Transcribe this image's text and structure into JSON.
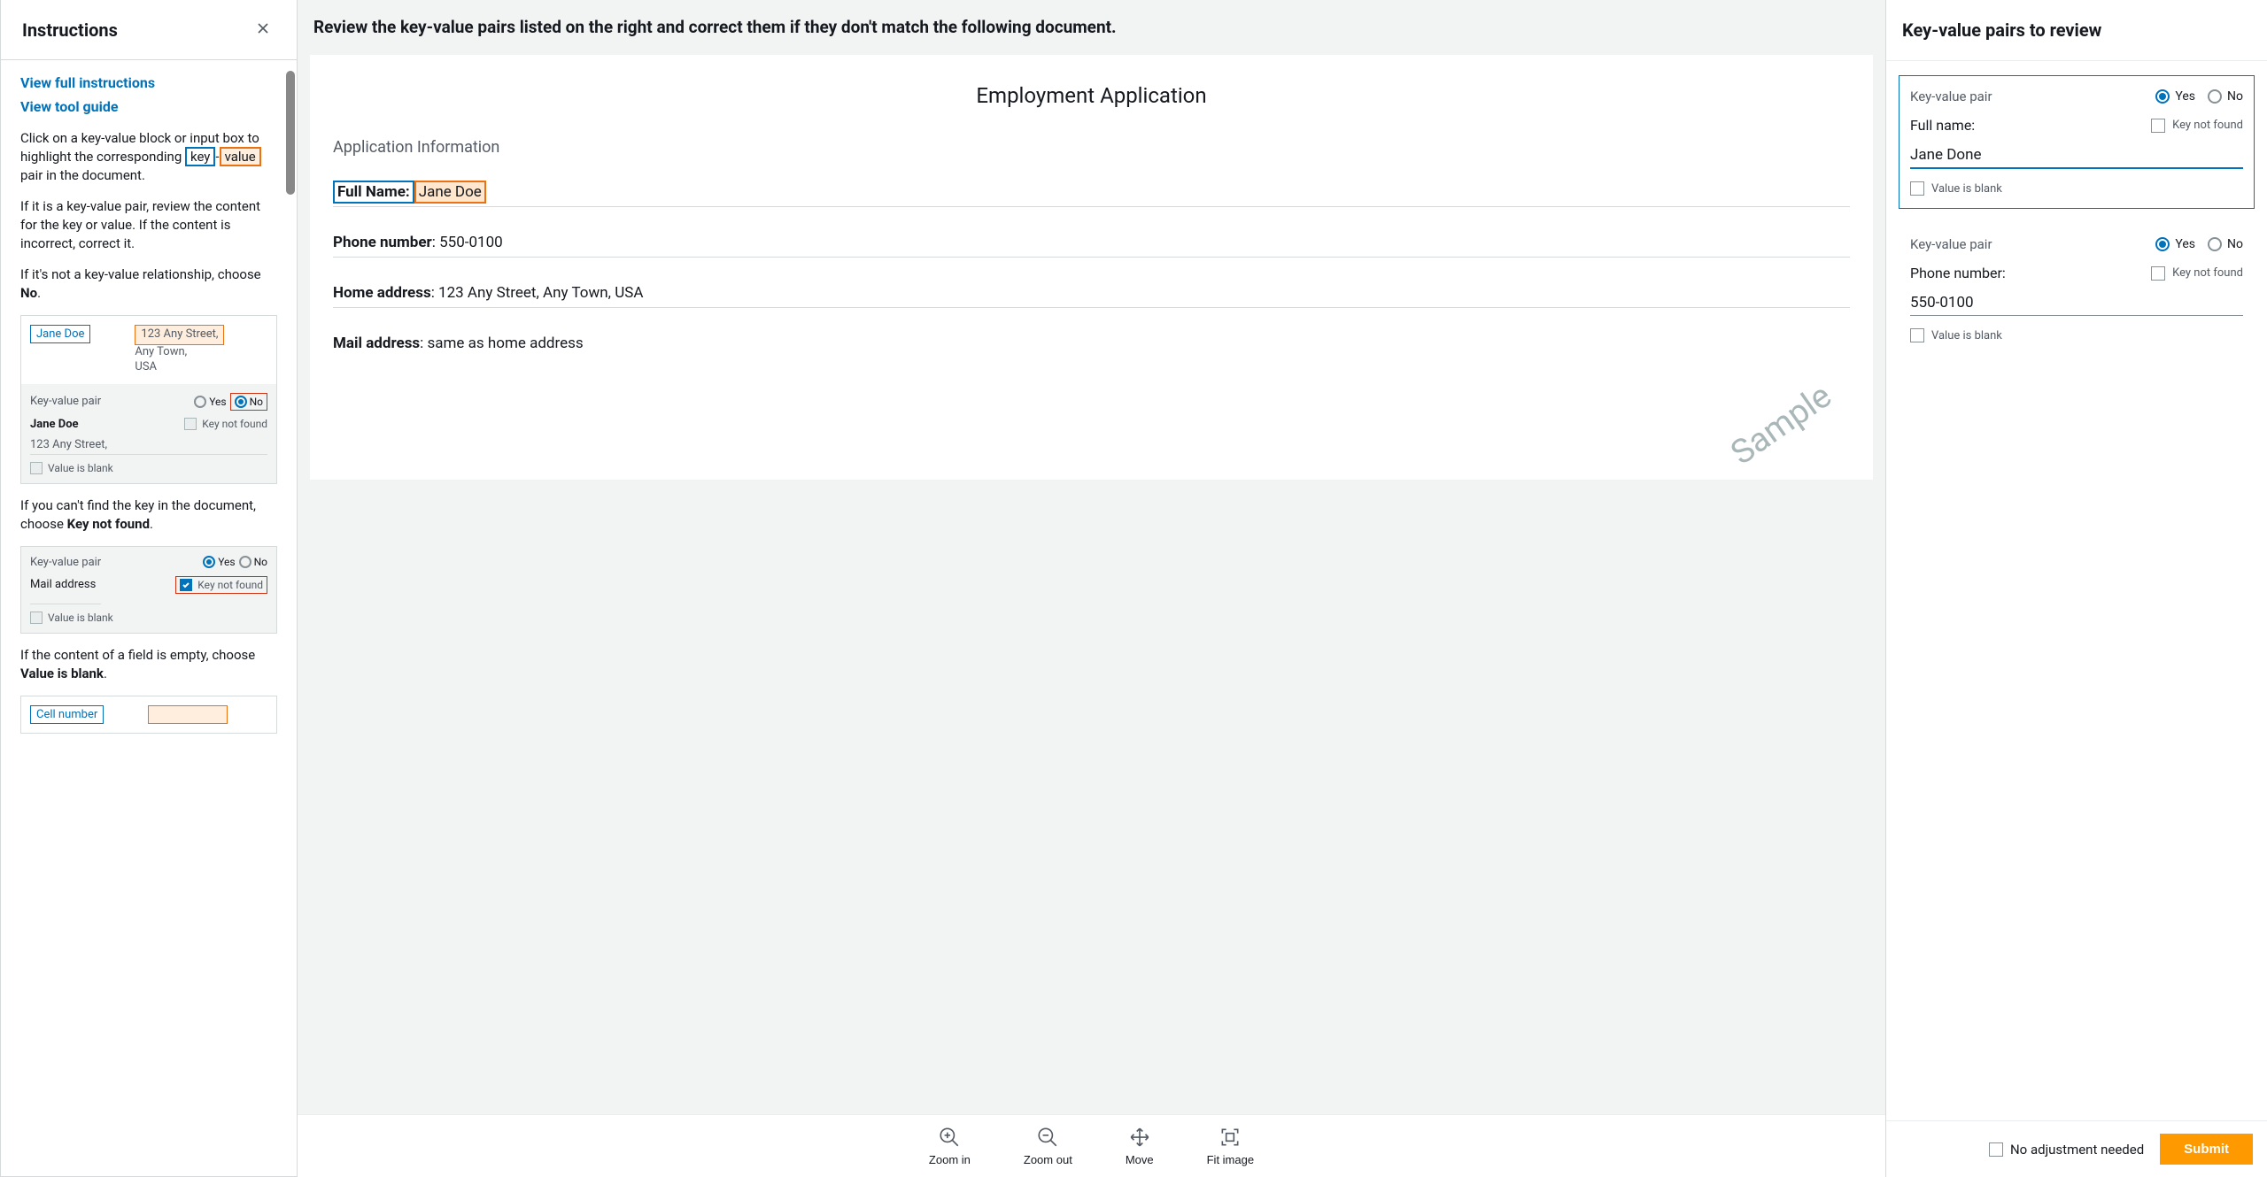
{
  "instructions": {
    "title": "Instructions",
    "links": {
      "full_instructions": "View full instructions",
      "tool_guide": "View tool guide"
    },
    "paragraphs": {
      "p1_before": "Click on a key-value block or input box to highlight the corresponding ",
      "p1_key": "key",
      "p1_sep": "-",
      "p1_value": "value",
      "p1_after": " pair in the document.",
      "p2": "If it is a key-value pair, review the content for the key or value. If the content is incorrect, correct it.",
      "p3_before": "If it's not a key-value relationship, choose ",
      "p3_bold": "No",
      "p3_after": ".",
      "p4_before": "If you can't find the key in the document, choose ",
      "p4_bold": "Key not found",
      "p4_after": ".",
      "p5_before": "If the content of a field is empty, choose ",
      "p5_bold": "Value is blank",
      "p5_after": "."
    },
    "example1": {
      "key_text": "Jane Doe",
      "value_line1": "123 Any Street,",
      "addr_line2": "Any Town,",
      "addr_line3": "USA",
      "kvp_label": "Key-value pair",
      "yes": "Yes",
      "no": "No",
      "name": "Jane Doe",
      "key_not_found": "Key not found",
      "address": "123 Any Street,",
      "value_blank": "Value is blank"
    },
    "example2": {
      "kvp_label": "Key-value pair",
      "yes": "Yes",
      "no": "No",
      "mail_address": "Mail address",
      "key_not_found": "Key not found",
      "value_blank": "Value is blank"
    },
    "example3": {
      "cell_number": "Cell number"
    }
  },
  "center": {
    "review_text": "Review the key-value pairs listed on the right and correct them if they don't match the following document.",
    "doc": {
      "title": "Employment Application",
      "section": "Application Information",
      "fields": {
        "full_name_key": "Full Name:",
        "full_name_value": "Jane Doe",
        "phone_key": "Phone number",
        "phone_value": ": 550-0100",
        "home_key": "Home address",
        "home_value": ": 123 Any Street, Any Town, USA",
        "mail_key": "Mail address",
        "mail_value": ": same as home address"
      },
      "watermark": "Sample"
    },
    "toolbar": {
      "zoom_in": "Zoom in",
      "zoom_out": "Zoom out",
      "move": "Move",
      "fit_image": "Fit image"
    }
  },
  "right": {
    "title": "Key-value pairs to review",
    "labels": {
      "kvp": "Key-value pair",
      "yes": "Yes",
      "no": "No",
      "key_not_found": "Key not found",
      "value_blank": "Value is blank"
    },
    "items": [
      {
        "key": "Full name:",
        "value": "Jane Done",
        "selected": "yes",
        "active": true
      },
      {
        "key": "Phone number:",
        "value": "550-0100",
        "selected": "yes",
        "active": false
      }
    ],
    "footer": {
      "no_adjust": "No adjustment needed",
      "submit": "Submit"
    }
  }
}
